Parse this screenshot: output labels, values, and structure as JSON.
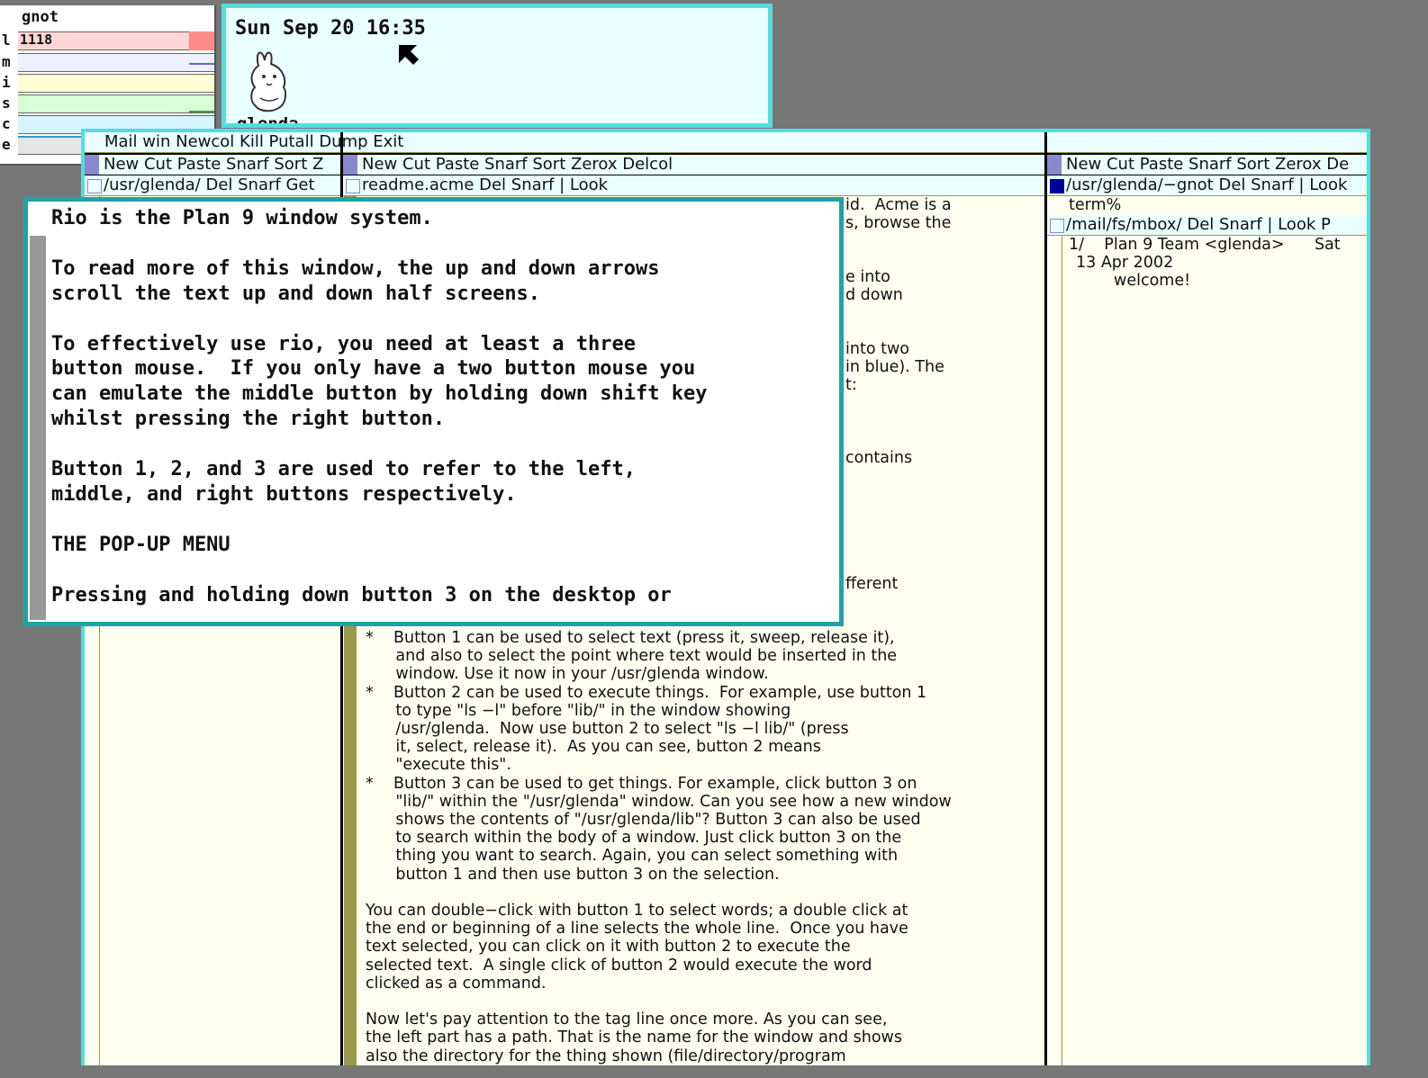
{
  "stats": {
    "title": "gnot",
    "rows": [
      {
        "label": "l",
        "value": "1118",
        "color": "#ffd6d6",
        "spark": "#ff8a8a"
      },
      {
        "label": "m",
        "value": "",
        "color": "#eef0ff",
        "spark": "#6666dd"
      },
      {
        "label": "i",
        "value": "",
        "color": "#ffffd6",
        "spark": "#cccc66"
      },
      {
        "label": "s",
        "value": "",
        "color": "#d6ffd6",
        "spark": "#33aa33"
      },
      {
        "label": "c",
        "value": "",
        "color": "#d6f5ff",
        "spark": "#3399cc"
      },
      {
        "label": "e",
        "value": "",
        "color": "#e5e5e5",
        "spark": "#999999"
      }
    ]
  },
  "clock": {
    "time": "Sun Sep 20 16:35",
    "user": "glenda"
  },
  "acme": {
    "main_tag": "Mail win Newcol Kill Putall Dump Exit",
    "col1": {
      "tag": "New Cut Paste Snarf Sort Z",
      "win_tag": "/usr/glenda/ Del Snarf Get"
    },
    "col2": {
      "tag": "New Cut Paste Snarf Sort Zerox Delcol",
      "win_tag": "readme.acme Del Snarf | Look",
      "visible_fragments": [
        "id.  Acme is a",
        "s, browse the",
        "e into",
        "d down",
        "into two",
        "in blue). The",
        "t:",
        "contains",
        "fferent"
      ],
      "body_lines": [
        "*    Button 1 can be used to select text (press it, sweep, release it),",
        "      and also to select the point where text would be inserted in the",
        "      window. Use it now in your /usr/glenda window.",
        "*    Button 2 can be used to execute things.  For example, use button 1",
        "      to type \"ls −l\" before \"lib/\" in the window showing",
        "      /usr/glenda.  Now use button 2 to select \"ls −l lib/\" (press",
        "      it, select, release it).  As you can see, button 2 means",
        "      \"execute this\".",
        "*    Button 3 can be used to get things. For example, click button 3 on",
        "      \"lib/\" within the \"/usr/glenda\" window. Can you see how a new window",
        "      shows the contents of \"/usr/glenda/lib\"? Button 3 can also be used",
        "      to search within the body of a window. Just click button 3 on the",
        "      thing you want to search. Again, you can select something with",
        "      button 1 and then use button 3 on the selection.",
        "",
        "You can double−click with button 1 to select words; a double click at",
        "the end or beginning of a line selects the whole line.  Once you have",
        "text selected, you can click on it with button 2 to execute the",
        "selected text.  A single click of button 2 would execute the word",
        "clicked as a command.",
        "",
        "Now let's pay attention to the tag line once more. As you can see,",
        "the left part has a path. That is the name for the window and shows",
        "also the directory for the thing shown (file/directory/program"
      ]
    },
    "col3": {
      "tag": "New Cut Paste Snarf Sort Zerox De",
      "win1_tag": "/usr/glenda/−gnot Del Snarf | Look",
      "win1_body": "term%",
      "win2_tag": "/mail/fs/mbox/ Del Snarf | Look P",
      "mail_line1": "1/    Plan 9 Team <glenda>      Sat",
      "mail_line2": "13 Apr 2002",
      "mail_line3": "welcome!"
    }
  },
  "rio": {
    "lines": [
      "Rio is the Plan 9 window system.",
      "",
      "To read more of this window, the up and down arrows",
      "scroll the text up and down half screens.",
      "",
      "To effectively use rio, you need at least a three",
      "button mouse.  If you only have a two button mouse you",
      "can emulate the middle button by holding down shift key",
      "whilst pressing the right button.",
      "",
      "Button 1, 2, and 3 are used to refer to the left,",
      "middle, and right buttons respectively.",
      "",
      "THE POP-UP MENU",
      "",
      "Pressing and holding down button 3 on the desktop or"
    ]
  }
}
